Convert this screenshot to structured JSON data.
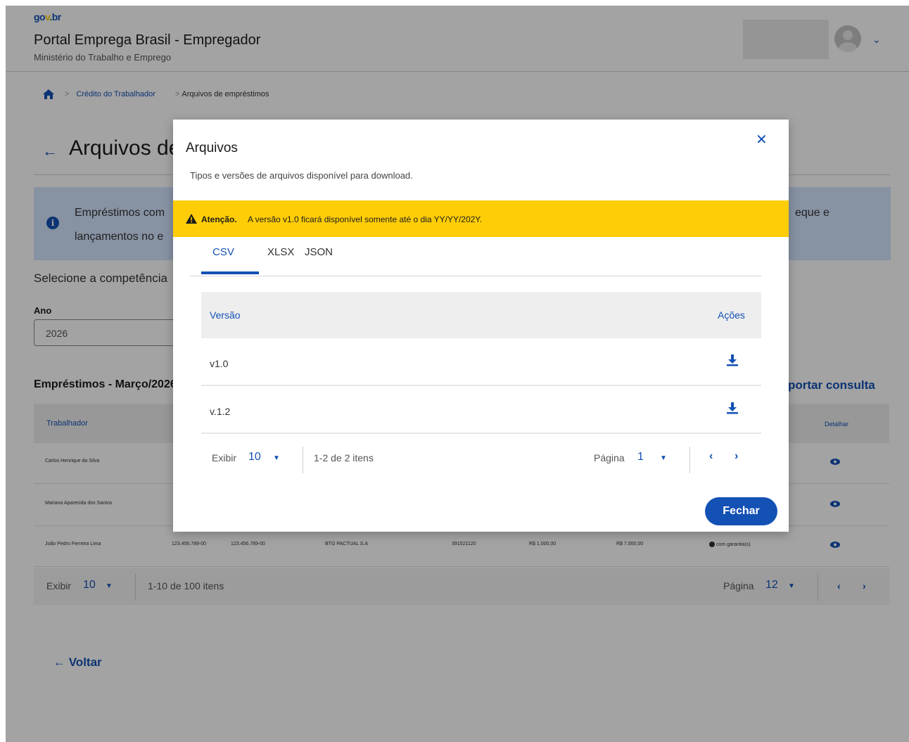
{
  "header": {
    "logo": {
      "part1": "go",
      "part2": "v",
      "part3": ".",
      "part4": "br"
    },
    "title": "Portal Emprega Brasil - Empregador",
    "subtitle": "Ministério do Trabalho e Emprego"
  },
  "breadcrumb": {
    "item1": "Crédito do Trabalhador",
    "item2": "Arquivos de empréstimos"
  },
  "page": {
    "title": "Arquivos de empréstimos",
    "info_line1": "Empréstimos com",
    "info_line2": "lançamentos no e",
    "info_right": "eque e",
    "select_label": "Selecione a competência",
    "year_label": "Ano",
    "year_value": "2026",
    "loans_title": "Empréstimos - Março/2026",
    "export_label": "portar consulta",
    "table": {
      "col_worker": "Trabalhador",
      "col_detail": "Detalhar",
      "rows": [
        {
          "worker": "Carlos Henrique da Silva"
        },
        {
          "worker": "Mariana Aparecida dos Santos"
        },
        {
          "worker": "João Pedro Ferreira Lima",
          "cpf": "123.456.789-00",
          "cnpj": "123.456.789-00",
          "bank": "BTG PACTUAL S.A",
          "contract": "391521120",
          "installment": "R$ 1.000,00",
          "total": "R$ 7.000,00",
          "status": "com garantia(s)"
        }
      ]
    },
    "pager": {
      "show_label": "Exibir",
      "show_value": "10",
      "range": "1-10 de 100 itens",
      "page_label": "Página",
      "page_value": "12"
    },
    "back_label": "Voltar"
  },
  "modal": {
    "title": "Arquivos",
    "description": "Tipos e versões de arquivos disponível para download.",
    "alert_strong": "Atenção.",
    "alert_text": "A versão v1.0 ficará disponível somente até o dia YY/YY/202Y.",
    "tabs": [
      "CSV",
      "XLSX",
      "JSON"
    ],
    "table": {
      "col_version": "Versão",
      "col_actions": "Ações",
      "rows": [
        {
          "version": "v1.0"
        },
        {
          "version": "v.1.2"
        }
      ]
    },
    "pager": {
      "show_label": "Exibir",
      "show_value": "10",
      "range": "1-2 de 2 itens",
      "page_label": "Página",
      "page_value": "1"
    },
    "close_button": "Fechar",
    "icons": {
      "close": "close-icon",
      "download": "download-icon",
      "warning": "warning-icon",
      "prev": "chevron-left-icon",
      "next": "chevron-right-icon"
    }
  },
  "colors": {
    "primary": "#1351b4",
    "alert": "#ffcd07",
    "info_bg": "#d4e5ff",
    "overlay": "rgba(0,0,0,0.36)"
  }
}
